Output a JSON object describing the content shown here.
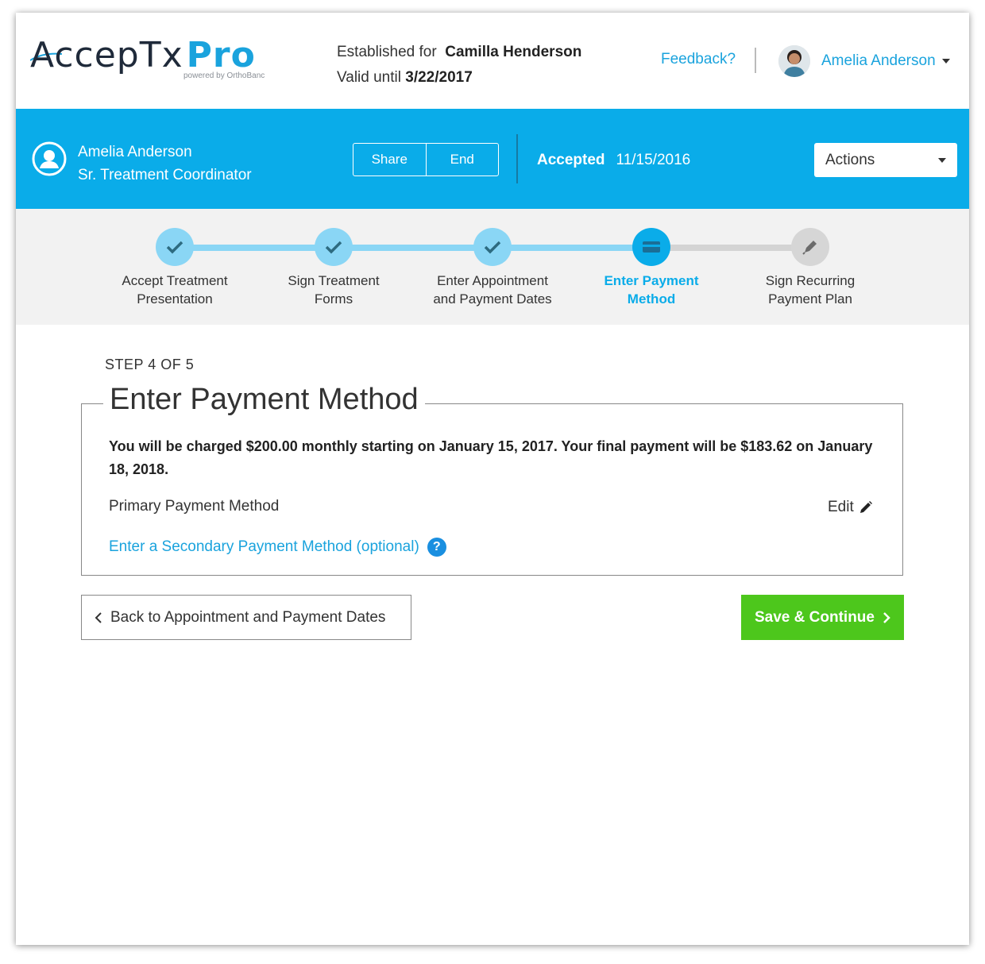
{
  "header": {
    "logo_text": "AccepTx",
    "logo_pro": "Pro",
    "logo_powered": "powered by OrthoBanc",
    "established_label": "Established for",
    "established_name": "Camilla Henderson",
    "valid_label": "Valid until",
    "valid_date": "3/22/2017",
    "feedback_label": "Feedback?",
    "user_name": "Amelia Anderson"
  },
  "coordinator_bar": {
    "name": "Amelia Anderson",
    "title": "Sr. Treatment Coordinator",
    "share_label": "Share",
    "end_label": "End",
    "status_label": "Accepted",
    "status_date": "11/15/2016",
    "actions_label": "Actions"
  },
  "stepper": {
    "steps": [
      {
        "line1": "Accept Treatment",
        "line2": "Presentation",
        "state": "done",
        "icon": "check-icon"
      },
      {
        "line1": "Sign Treatment",
        "line2": "Forms",
        "state": "done",
        "icon": "check-icon"
      },
      {
        "line1": "Enter Appointment",
        "line2": "and Payment Dates",
        "state": "done",
        "icon": "check-icon"
      },
      {
        "line1": "Enter Payment",
        "line2": "Method",
        "state": "active",
        "icon": "credit-card-icon"
      },
      {
        "line1": "Sign Recurring",
        "line2": "Payment Plan",
        "state": "todo",
        "icon": "pen-icon"
      }
    ]
  },
  "main": {
    "step_count": "STEP 4 OF 5",
    "section_title": "Enter Payment Method",
    "charge_text": "You will be charged $200.00 monthly starting on January 15, 2017. Your final payment will be $183.62 on January 18, 2018.",
    "primary_label": "Primary Payment Method",
    "edit_label": "Edit",
    "secondary_link": "Enter a Secondary Payment Method (optional)",
    "help_glyph": "?",
    "back_label": "Back to Appointment and Payment Dates",
    "save_label": "Save & Continue"
  },
  "colors": {
    "accent": "#0aace9",
    "link": "#1aa3dd",
    "success": "#4dc71c",
    "step_done": "#8ad6f5"
  }
}
